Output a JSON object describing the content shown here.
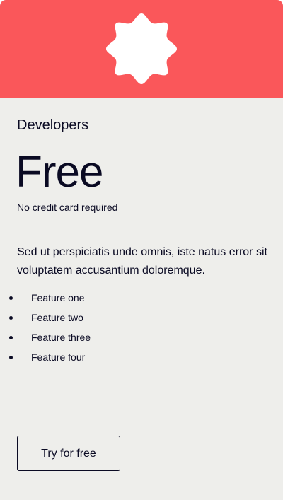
{
  "plan": {
    "name": "Developers",
    "price": "Free",
    "price_note": "No credit card required",
    "description": "Sed ut perspiciatis unde omnis, iste natus error sit voluptatem accusantium doloremque.",
    "features": [
      "Feature one",
      "Feature two",
      "Feature three",
      "Feature four"
    ],
    "cta_label": "Try for free",
    "icon": "badge-icon"
  },
  "colors": {
    "header": "#fa575a",
    "card_background": "#eeeeeb",
    "text": "#0a0a23",
    "icon_fill": "#ffffff"
  }
}
